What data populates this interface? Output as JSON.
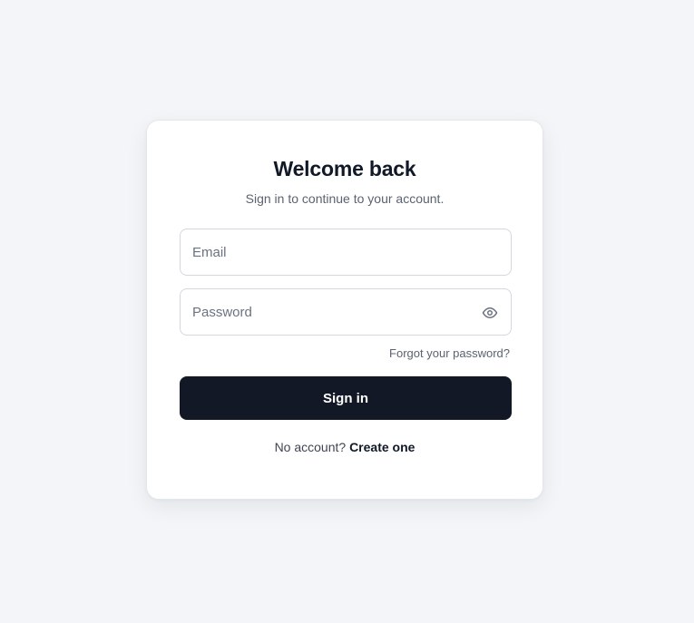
{
  "login": {
    "title": "Welcome back",
    "subtitle": "Sign in to continue to your account.",
    "email": {
      "value": "",
      "placeholder": "Email"
    },
    "password": {
      "value": "",
      "placeholder": "Password",
      "toggle_icon": "eye-icon"
    },
    "forgot_link": "Forgot your password?",
    "submit_label": "Sign in",
    "footer": {
      "prompt": "No account?",
      "link": "Create one"
    }
  },
  "colors": {
    "background": "#f3f5f8",
    "card": "#ffffff",
    "primary_button": "#131826",
    "heading": "#111827",
    "muted_text": "#5b6270"
  }
}
